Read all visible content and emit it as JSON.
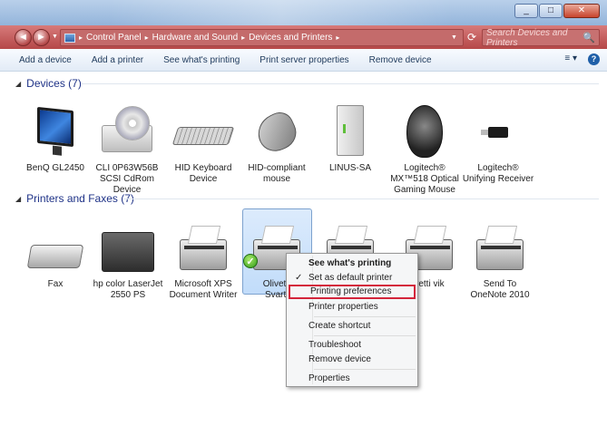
{
  "window": {
    "min_label": "_",
    "max_label": "□",
    "close_label": "✕"
  },
  "address": {
    "back_icon": "◄",
    "forward_icon": "►",
    "crumbs": [
      "Control Panel",
      "Hardware and Sound",
      "Devices and Printers"
    ],
    "refresh_icon": "⟳",
    "search_placeholder": "Search Devices and Printers",
    "search_icon": "🔍"
  },
  "toolbar": {
    "add_device": "Add a device",
    "add_printer": "Add a printer",
    "see_printing": "See what's printing",
    "print_server": "Print server properties",
    "remove_device": "Remove device",
    "views_icon": "≡ ▾",
    "help_icon": "?"
  },
  "devices": {
    "header": "Devices (7)",
    "items": [
      {
        "label": "BenQ GL2450",
        "icon": "monitor-icon"
      },
      {
        "label": "CLI 0P63W56B\nSCSI CdRom\nDevice",
        "icon": "cdrom-icon"
      },
      {
        "label": "HID Keyboard\nDevice",
        "icon": "keyboard-icon"
      },
      {
        "label": "HID-compliant\nmouse",
        "icon": "mouse-icon"
      },
      {
        "label": "LINUS-SA",
        "icon": "nas-icon"
      },
      {
        "label": "Logitech®\nMX™518 Optical\nGaming Mouse",
        "icon": "gaming-mouse-icon"
      },
      {
        "label": "Logitech®\nUnifying Receiver",
        "icon": "usb-receiver-icon"
      }
    ]
  },
  "printers": {
    "header": "Printers and Faxes (7)",
    "items": [
      {
        "label": "Fax",
        "icon": "fax-icon"
      },
      {
        "label": "hp color LaserJet\n2550 PS",
        "icon": "multifunction-printer-icon"
      },
      {
        "label": "Microsoft XPS\nDocument Writer",
        "icon": "printer-icon"
      },
      {
        "label": "Olivetti\nSvart/",
        "icon": "printer-icon"
      },
      {
        "label": "",
        "icon": "printer-icon"
      },
      {
        "label": "vetti vik",
        "icon": "printer-icon"
      },
      {
        "label": "Send To\nOneNote 2010",
        "icon": "printer-icon"
      }
    ]
  },
  "context_menu": {
    "items": [
      "See what's printing",
      "Set as default printer",
      "Printing preferences",
      "Printer properties",
      "Create shortcut",
      "Troubleshoot",
      "Remove device",
      "Properties"
    ],
    "check": "✓"
  }
}
